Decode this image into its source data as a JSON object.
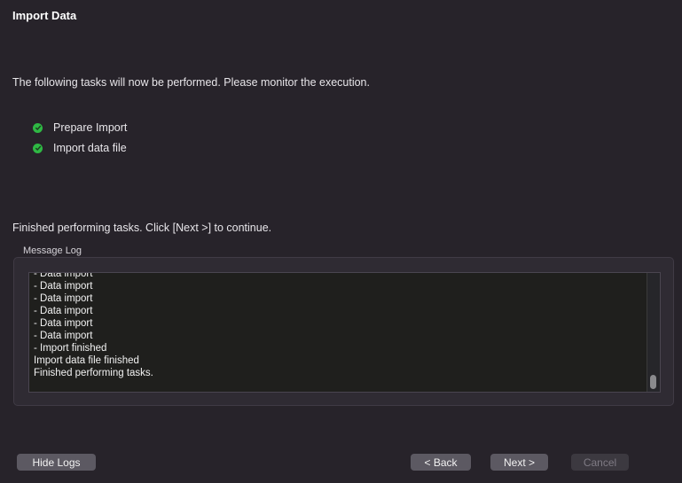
{
  "window": {
    "title": "Import Data"
  },
  "intro_text": "The following tasks will now be performed. Please monitor the execution.",
  "tasks": [
    {
      "label": "Prepare Import",
      "status": "done"
    },
    {
      "label": "Import data file",
      "status": "done"
    }
  ],
  "finished_text": "Finished performing tasks. Click [Next >] to continue.",
  "message_log": {
    "caption": "Message Log",
    "lines": [
      "- Data import",
      "- Data import",
      "- Data import",
      "- Data import",
      "- Data import",
      "- Data import",
      "- Import finished",
      "Import data file finished",
      "Finished performing tasks."
    ]
  },
  "buttons": {
    "hide_logs": "Hide Logs",
    "back": "< Back",
    "next": "Next >",
    "cancel": "Cancel"
  },
  "colors": {
    "background": "#27232a",
    "check_green": "#2fb844",
    "log_background": "#1f1f1d",
    "button": "#5c5962"
  },
  "icons": {
    "task_status": "green-check-circle-icon"
  }
}
